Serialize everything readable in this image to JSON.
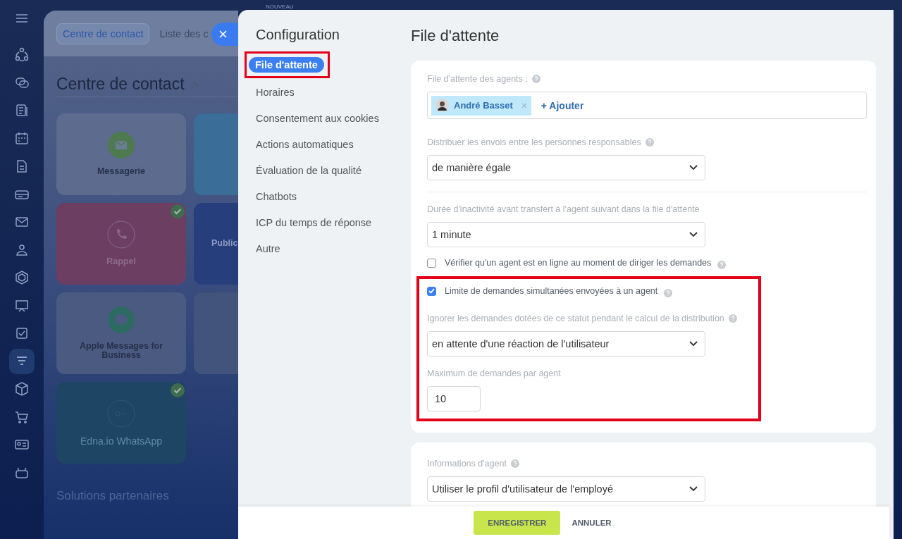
{
  "background_page": {
    "badge": "NOUVEAU",
    "tabs": [
      {
        "label": "Centre de contact",
        "selected": true
      },
      {
        "label": "Liste des c",
        "selected": false
      }
    ],
    "title": "Centre de contact",
    "tiles": [
      {
        "label": "Messagerie",
        "kind": "mail",
        "color": "#5d6c8e",
        "connected": false
      },
      {
        "kind": "plain",
        "color": "#3b6d99"
      },
      {
        "label": "Rappel",
        "kind": "phone",
        "color": "#6b3e62",
        "connected": true
      },
      {
        "label": "Public",
        "kind": "plain",
        "color": "#263f7c"
      },
      {
        "label": "Apple Messages for Business",
        "kind": "chat",
        "color": "#4a5a80",
        "connected": false
      },
      {
        "kind": "plain",
        "color": "#42547c"
      },
      {
        "label": "Edna.io WhatsApp",
        "kind": "edna",
        "color": "#1e4563",
        "connected": true
      }
    ],
    "section_title": "Solutions partenaires"
  },
  "configuration": {
    "title": "Configuration",
    "menu": [
      {
        "label": "File d'attente",
        "selected": true
      },
      {
        "label": "Horaires",
        "selected": false
      },
      {
        "label": "Consentement aux cookies",
        "selected": false
      },
      {
        "label": "Actions automatiques",
        "selected": false
      },
      {
        "label": "Évaluation de la qualité",
        "selected": false
      },
      {
        "label": "Chatbots",
        "selected": false
      },
      {
        "label": "ICP du temps de réponse",
        "selected": false
      },
      {
        "label": "Autre",
        "selected": false
      }
    ],
    "page_title": "File d'attente",
    "agents_label": "File d'attente des agents :",
    "agents": [
      {
        "name": "André Basset"
      }
    ],
    "add_link": "+ Ajouter",
    "distribute_label": "Distribuer les envois entre les personnes responsables",
    "distribute_value": "de manière égale",
    "inactivity_label": "Durée d'inactivité avant transfert à l'agent suivant dans la file d'attente",
    "inactivity_value": "1 minute",
    "check_online": {
      "label": "Vérifier qu'un agent est en ligne au moment de diriger les demandes",
      "checked": false
    },
    "limit": {
      "label": "Limite de demandes simultanées envoyées à un agent",
      "checked": true
    },
    "ignore_label": "Ignorer les demandes dotées de ce statut pendant le calcul de la distribution",
    "ignore_value": "en attente d'une réaction de l'utilisateur",
    "max_label": "Maximum de demandes par agent",
    "max_value": "10",
    "info_label": "Informations d'agent",
    "info_value": "Utiliser le profil d'utilisateur de l'employé"
  },
  "footer": {
    "save": "ENREGISTRER",
    "cancel": "ANNULER"
  }
}
